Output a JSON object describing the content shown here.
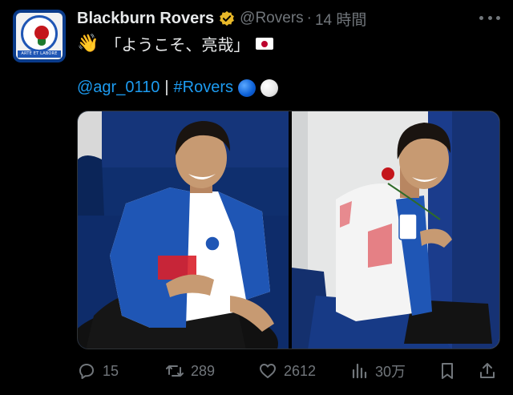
{
  "account": {
    "display_name": "Blackburn Rovers",
    "handle": "@Rovers",
    "separator": "·",
    "time": "14 時間",
    "avatar_icon": "blackburn-rovers-crest",
    "avatar_motto": "ARTE ET LABORE",
    "verified_icon": "verified-gold-badge"
  },
  "tweet": {
    "emoji": "👋",
    "line1": "「ようこそ、亮哉」",
    "flag_icon": "japan-flag",
    "mention": "@agr_0110",
    "divider": "|",
    "hashtag": "#Rovers",
    "balls": [
      "blue-circle",
      "white-circle"
    ]
  },
  "media": {
    "image_count": 2,
    "images": [
      "player-seated-front",
      "player-seated-back-with-rose"
    ]
  },
  "actions": {
    "reply_count": "15",
    "retweet_count": "289",
    "like_count": "2612",
    "views_count": "30万"
  },
  "colors": {
    "background": "#000000",
    "text": "#e7e9ea",
    "muted": "#71767b",
    "link": "#1d9bf0",
    "verified": "#e8b829",
    "kit_blue": "#1f56b5"
  }
}
